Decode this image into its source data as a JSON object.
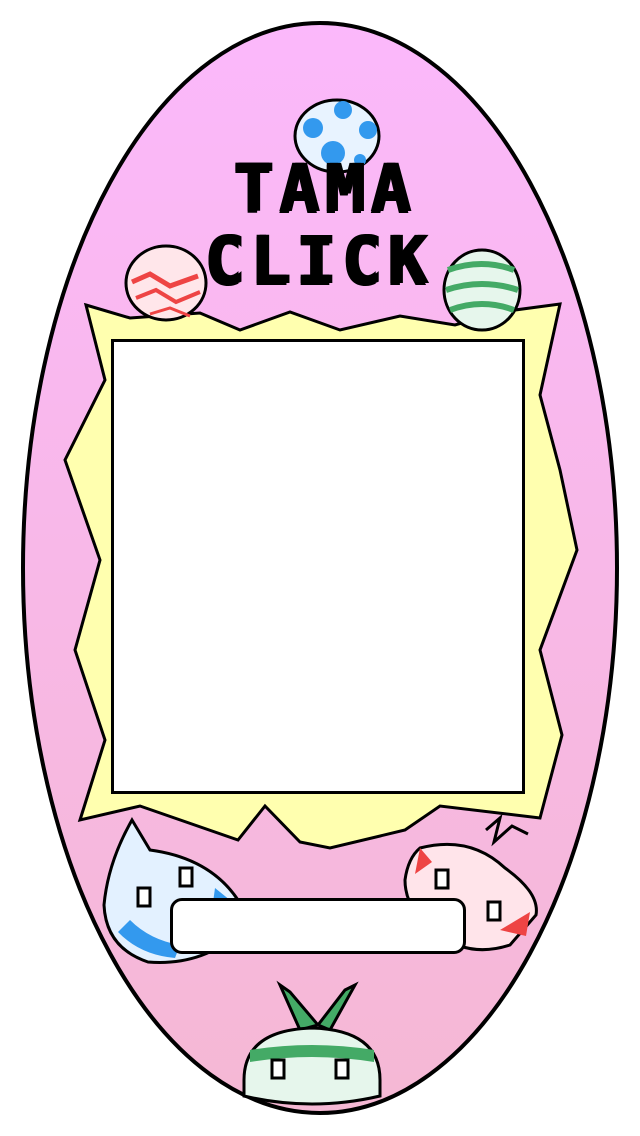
{
  "app": {
    "title_line_1": "TAMA",
    "title_line_2": "CLICK",
    "status_text": ""
  },
  "colors": {
    "shell_top": "#fbb8fb",
    "shell_bottom": "#f5b8d4",
    "outline": "#000000",
    "frame": "#ffffaf",
    "screen": "#ffffff",
    "egg_blue": "#3399ee",
    "egg_red": "#ee4444",
    "egg_green": "#44aa66"
  },
  "icons": [
    "blue-spotted-egg-icon",
    "red-striped-egg-icon",
    "green-striped-egg-icon",
    "blue-blob-creature-icon",
    "red-fluff-creature-icon",
    "green-sprout-creature-icon"
  ]
}
